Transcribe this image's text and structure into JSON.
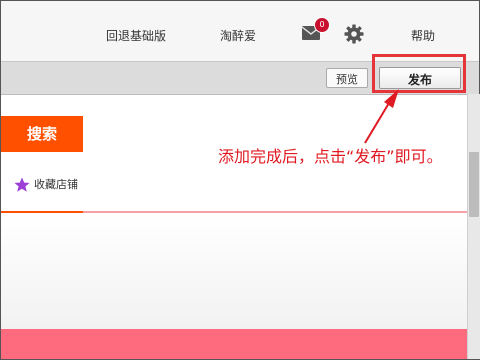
{
  "nav": {
    "revert_basic": "回退基础版",
    "taobao_love": "淘醉爱",
    "mail_count": "0",
    "help": "帮助"
  },
  "toolbar": {
    "preview": "预览",
    "publish": "发布"
  },
  "left_panel": {
    "search": "搜索",
    "fav_store": "收藏店铺"
  },
  "annotation": {
    "text": "添加完成后，点击“发布”即可。"
  },
  "colors": {
    "accent_orange": "#ff5000",
    "annotation_red": "#e01a22",
    "pink_band": "#ff6b7e",
    "badge_red": "#c8102e"
  }
}
